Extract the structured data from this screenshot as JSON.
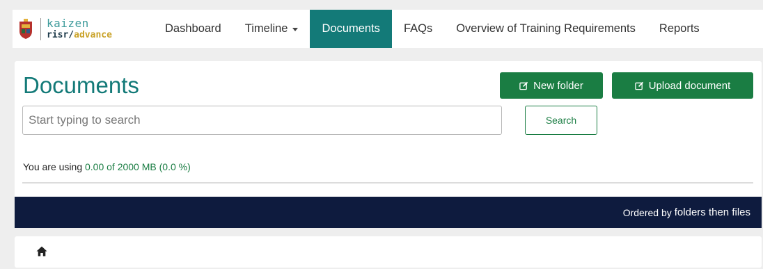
{
  "brand": {
    "line1": "kaizen",
    "line2_part1": "risr/",
    "line2_part2": "advance",
    "crest_icon": "crest-icon"
  },
  "nav": {
    "items": [
      {
        "label": "Dashboard",
        "active": false
      },
      {
        "label": "Timeline",
        "active": false,
        "has_caret": true
      },
      {
        "label": "Documents",
        "active": true
      },
      {
        "label": "FAQs",
        "active": false
      },
      {
        "label": "Overview of Training Requirements",
        "active": false
      },
      {
        "label": "Reports",
        "active": false
      }
    ]
  },
  "page": {
    "title": "Documents",
    "new_folder_label": "New folder",
    "upload_label": "Upload document"
  },
  "search": {
    "placeholder": "Start typing to search",
    "value": "",
    "button_label": "Search"
  },
  "usage": {
    "prefix": "You are using",
    "value": "0.00 of 2000 MB (0.0 %)",
    "used_mb": 0.0,
    "total_mb": 2000,
    "percent": 0.0
  },
  "ordering": {
    "prefix": "Ordered by",
    "value": "folders then files"
  },
  "breadcrumb": {
    "home_icon": "home-icon"
  },
  "colors": {
    "brand_teal": "#137a78",
    "action_green": "#1a7d43",
    "navy_bar": "#0e1b3e",
    "background": "#eeeeee"
  }
}
